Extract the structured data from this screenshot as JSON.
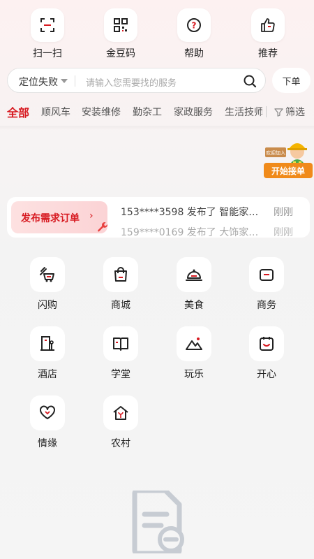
{
  "top_actions": [
    {
      "label": "扫一扫",
      "icon": "scan-icon"
    },
    {
      "label": "金豆码",
      "icon": "qr-code-icon"
    },
    {
      "label": "帮助",
      "icon": "help-icon"
    },
    {
      "label": "推荐",
      "icon": "thumb-up-icon"
    }
  ],
  "search": {
    "location": "定位失败",
    "placeholder": "请输入您需要找的服务",
    "order_label": "下单"
  },
  "categories": [
    "全部",
    "顺风车",
    "安装维修",
    "勤杂工",
    "家政服务",
    "生活技师"
  ],
  "filter_label": "筛选",
  "mascot": {
    "button_label": "开始接单",
    "sign_text": "欢迎加入"
  },
  "request": {
    "tag_label": "发布需求订单",
    "feed": [
      {
        "text": "153****3598 发布了 智能家…",
        "time": "刚刚"
      },
      {
        "text": "159****0169 发布了 大饰家…",
        "time": "刚刚"
      }
    ]
  },
  "services": [
    {
      "label": "闪购",
      "icon": "flash-buy-icon"
    },
    {
      "label": "商城",
      "icon": "shopping-bag-icon"
    },
    {
      "label": "美食",
      "icon": "food-cloche-icon"
    },
    {
      "label": "商务",
      "icon": "business-icon"
    },
    {
      "label": "酒店",
      "icon": "hotel-icon"
    },
    {
      "label": "学堂",
      "icon": "book-icon"
    },
    {
      "label": "玩乐",
      "icon": "mountain-icon"
    },
    {
      "label": "开心",
      "icon": "calendar-smile-icon"
    },
    {
      "label": "情缘",
      "icon": "heart-icon"
    },
    {
      "label": "农村",
      "icon": "farm-house-icon"
    }
  ],
  "colors": {
    "accent": "#d71920",
    "orange": "#f08a1a"
  }
}
